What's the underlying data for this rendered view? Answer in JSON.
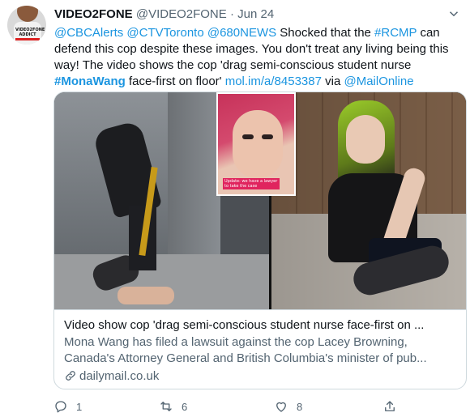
{
  "tweet": {
    "author_name": "VIDEO2FONE",
    "author_handle": "@VIDEO2FONE",
    "separator": "·",
    "date": "Jun 24",
    "avatar_text": "VIDEO2FONE ADDICT",
    "body": {
      "mention1": "@CBCAlerts",
      "mention2": "@CTVToronto",
      "mention3": "@680NEWS",
      "text1": "  Shocked that the ",
      "hashtag1": "#RCMP",
      "text2": " can defend this cop despite these images. You don't treat any living being this way! The video shows the cop 'drag semi-conscious student nurse ",
      "hashtag2": "#MonaWang",
      "text3": " face-first on floor' ",
      "link": "mol.im/a/8453387",
      "text4": " via ",
      "mention4": "@MailOnline"
    }
  },
  "card": {
    "inset_caption": "Update: we have a lawyer to take the case",
    "title": "Video show cop 'drag semi-conscious student nurse face-first on ...",
    "description_line1": "Mona Wang has filed a lawsuit against the cop Lacey Browning,",
    "description_line2": "Canada's Attorney General and British Columbia's minister of pub...",
    "domain": "dailymail.co.uk"
  },
  "actions": {
    "reply_count": "1",
    "retweet_count": "6",
    "like_count": "8"
  },
  "colors": {
    "link": "#1b95e0",
    "secondary_text": "#536471",
    "border": "#cfd9de"
  },
  "icons": [
    "chevron-down-icon",
    "link-icon",
    "reply-icon",
    "retweet-icon",
    "like-icon",
    "share-icon"
  ]
}
